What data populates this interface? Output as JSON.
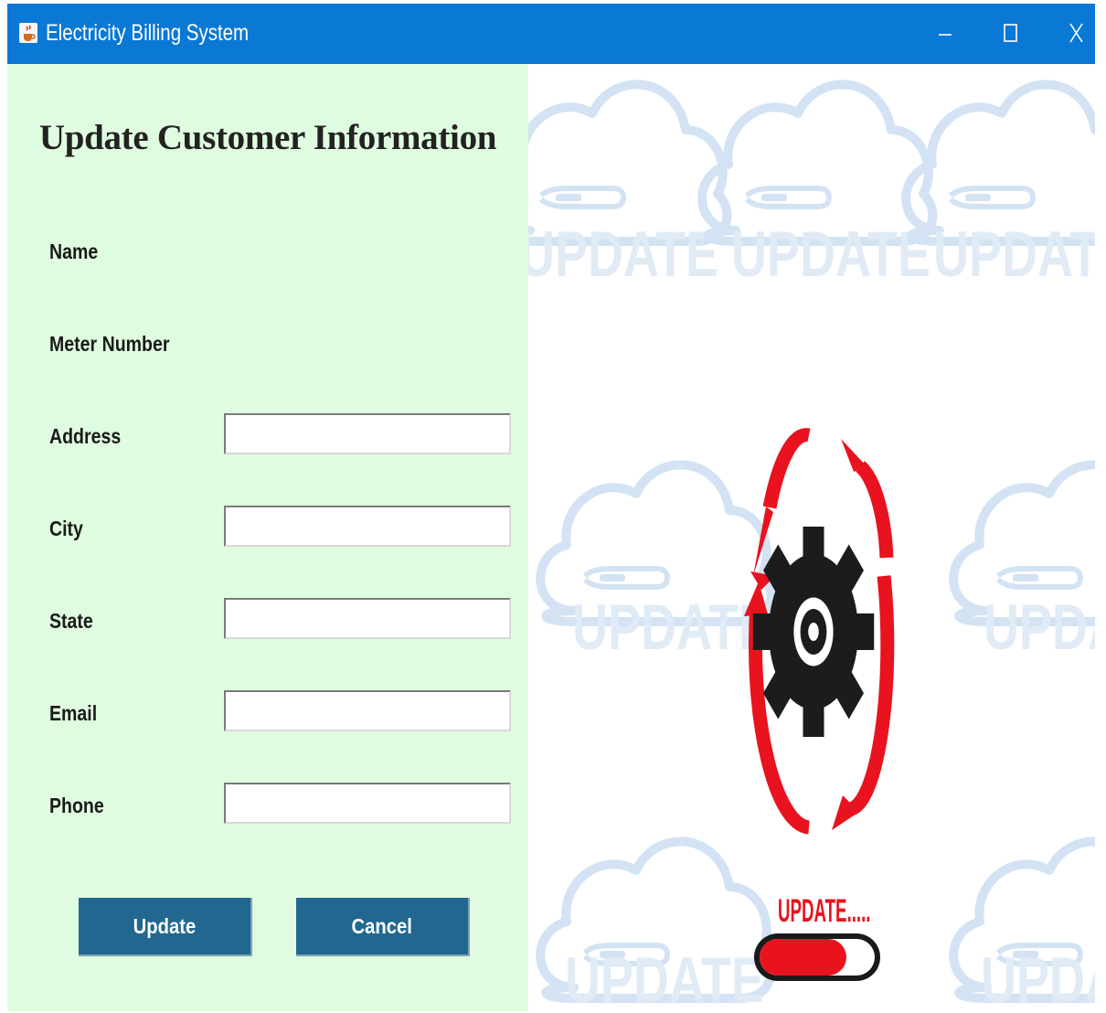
{
  "window": {
    "title": "Electricity Billing System",
    "icon": "java-cup-icon",
    "controls": [
      "minimize-icon",
      "maximize-icon",
      "close-icon"
    ]
  },
  "form": {
    "heading": "Update Customer Information",
    "fields": [
      {
        "label": "Name",
        "value": ""
      },
      {
        "label": "Meter Number",
        "value": ""
      },
      {
        "label": "Address",
        "value": ""
      },
      {
        "label": "City",
        "value": ""
      },
      {
        "label": "State",
        "value": ""
      },
      {
        "label": "Email",
        "value": ""
      },
      {
        "label": "Phone",
        "value": ""
      }
    ],
    "buttons": {
      "update": "Update",
      "cancel": "Cancel"
    }
  },
  "illustration": {
    "caption": "UPDATE.....",
    "cloud_text": "UPDATE",
    "progress": 0.75,
    "colors": {
      "accent_red": "#e8131f",
      "gear": "#1c1c1c",
      "cloud": "#cfe0f2",
      "titlebar": "#0a78d5",
      "button": "#22678f",
      "panel": "#e0fce0"
    }
  }
}
